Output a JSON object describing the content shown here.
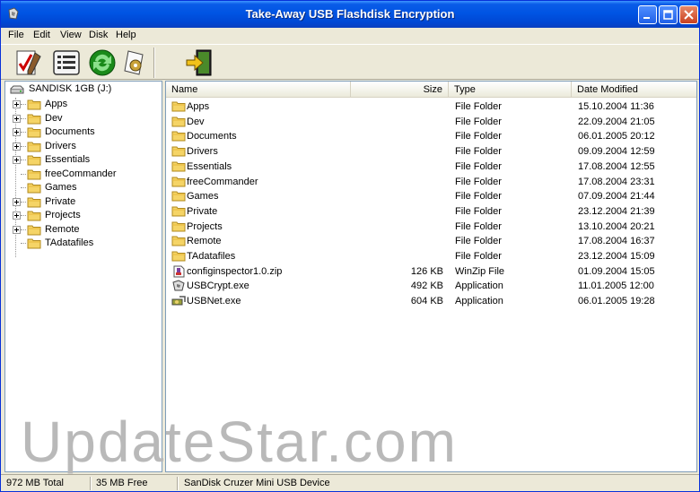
{
  "window": {
    "title": "Take-Away USB Flashdisk Encryption"
  },
  "menu": [
    "File",
    "Edit",
    "View",
    "Disk",
    "Help"
  ],
  "toolbar": {
    "tools": [
      {
        "name": "encrypt-tool",
        "icon": "checklist-pen-icon"
      },
      {
        "name": "list-tool",
        "icon": "list-icon"
      },
      {
        "name": "refresh-tool",
        "icon": "refresh-icon"
      },
      {
        "name": "settings-tool",
        "icon": "gear-paper-icon"
      },
      {
        "name": "exit-tool",
        "icon": "exit-door-icon"
      }
    ]
  },
  "tree": {
    "root": "SANDISK 1GB (J:)",
    "items": [
      {
        "label": "Apps",
        "expandable": true
      },
      {
        "label": "Dev",
        "expandable": true
      },
      {
        "label": "Documents",
        "expandable": true
      },
      {
        "label": "Drivers",
        "expandable": true
      },
      {
        "label": "Essentials",
        "expandable": true
      },
      {
        "label": "freeCommander",
        "expandable": false
      },
      {
        "label": "Games",
        "expandable": false
      },
      {
        "label": "Private",
        "expandable": true
      },
      {
        "label": "Projects",
        "expandable": true
      },
      {
        "label": "Remote",
        "expandable": true
      },
      {
        "label": "TAdatafiles",
        "expandable": false
      }
    ]
  },
  "list": {
    "columns": {
      "name": "Name",
      "size": "Size",
      "type": "Type",
      "modified": "Date Modified"
    },
    "rows": [
      {
        "name": "Apps",
        "size": "",
        "type": "File Folder",
        "modified": "15.10.2004 11:36",
        "icon": "folder-icon"
      },
      {
        "name": "Dev",
        "size": "",
        "type": "File Folder",
        "modified": "22.09.2004 21:05",
        "icon": "folder-icon"
      },
      {
        "name": "Documents",
        "size": "",
        "type": "File Folder",
        "modified": "06.01.2005 20:12",
        "icon": "folder-icon"
      },
      {
        "name": "Drivers",
        "size": "",
        "type": "File Folder",
        "modified": "09.09.2004 12:59",
        "icon": "folder-icon"
      },
      {
        "name": "Essentials",
        "size": "",
        "type": "File Folder",
        "modified": "17.08.2004 12:55",
        "icon": "folder-icon"
      },
      {
        "name": "freeCommander",
        "size": "",
        "type": "File Folder",
        "modified": "17.08.2004 23:31",
        "icon": "folder-icon"
      },
      {
        "name": "Games",
        "size": "",
        "type": "File Folder",
        "modified": "07.09.2004 21:44",
        "icon": "folder-icon"
      },
      {
        "name": "Private",
        "size": "",
        "type": "File Folder",
        "modified": "23.12.2004 21:39",
        "icon": "folder-icon"
      },
      {
        "name": "Projects",
        "size": "",
        "type": "File Folder",
        "modified": "13.10.2004 20:21",
        "icon": "folder-icon"
      },
      {
        "name": "Remote",
        "size": "",
        "type": "File Folder",
        "modified": "17.08.2004 16:37",
        "icon": "folder-icon"
      },
      {
        "name": "TAdatafiles",
        "size": "",
        "type": "File Folder",
        "modified": "23.12.2004 15:09",
        "icon": "folder-icon"
      },
      {
        "name": "configinspector1.0.zip",
        "size": "126 KB",
        "type": "WinZip File",
        "modified": "01.09.2004 15:05",
        "icon": "zip-icon"
      },
      {
        "name": "USBCrypt.exe",
        "size": "492 KB",
        "type": "Application",
        "modified": "11.01.2005 12:00",
        "icon": "exe-icon"
      },
      {
        "name": "USBNet.exe",
        "size": "604 KB",
        "type": "Application",
        "modified": "06.01.2005 19:28",
        "icon": "net-exe-icon"
      }
    ]
  },
  "status": {
    "total": "972 MB Total",
    "free": "35 MB Free",
    "device": "SanDisk Cruzer Mini USB Device"
  },
  "watermark": "UpdateStar.com",
  "colors": {
    "title_blue": "#0054e3",
    "folder_yellow": "#f5d466",
    "chrome": "#ece9d8"
  }
}
